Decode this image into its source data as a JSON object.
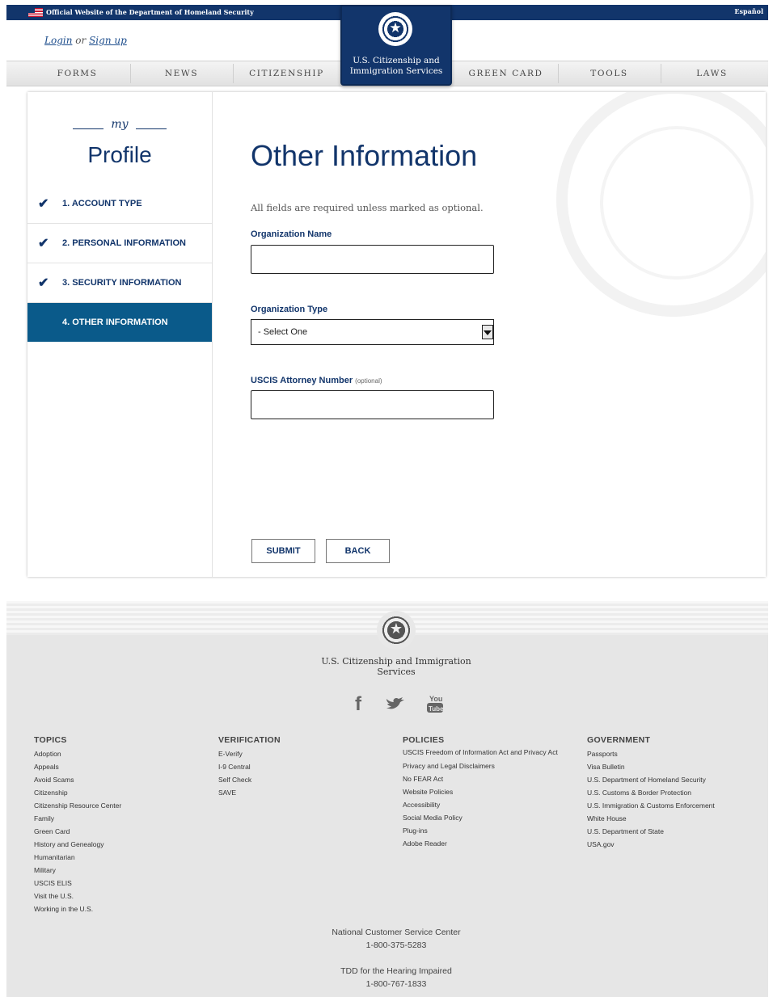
{
  "topbar": {
    "official_text": "Official Website of the Department of Homeland Security",
    "language_link": "Español"
  },
  "header": {
    "login_label": "Login",
    "or_label": "or",
    "signup_label": "Sign up",
    "logo_text": "U.S. Citizenship and Immigration Services",
    "nav": [
      "FORMS",
      "NEWS",
      "CITIZENSHIP",
      "GREEN CARD",
      "TOOLS",
      "LAWS"
    ]
  },
  "sidebar": {
    "decoration_text": "my",
    "title": "Profile",
    "steps": [
      {
        "label": "1. ACCOUNT TYPE",
        "completed": true
      },
      {
        "label": "2. PERSONAL INFORMATION",
        "completed": true
      },
      {
        "label": "3. SECURITY INFORMATION",
        "completed": true
      },
      {
        "label": "4. OTHER INFORMATION",
        "completed": false,
        "active": true
      }
    ],
    "check_icon": "✔"
  },
  "form": {
    "title": "Other Information",
    "required_note": "All fields are required unless marked as optional.",
    "org_name_label": "Organization Name",
    "org_name_value": "",
    "org_type_label": "Organization Type",
    "org_type_selected": "- Select One",
    "attorney_label": "USCIS Attorney Number",
    "attorney_optional": "(optional)",
    "attorney_value": "",
    "submit_label": "SUBMIT",
    "back_label": "BACK"
  },
  "footer": {
    "logo_text": "U.S. Citizenship and Immigration Services",
    "social": [
      "facebook-icon",
      "twitter-icon",
      "youtube-icon"
    ],
    "columns": [
      {
        "heading": "TOPICS",
        "links": [
          "Adoption",
          "Appeals",
          "Avoid Scams",
          "Citizenship",
          "Citizenship Resource Center",
          "Family",
          "Green Card",
          "History and Genealogy",
          "Humanitarian",
          "Military",
          "USCIS ELIS",
          "Visit the U.S.",
          "Working in the U.S."
        ]
      },
      {
        "heading": "VERIFICATION",
        "links": [
          "E-Verify",
          "I-9 Central",
          "Self Check",
          "SAVE"
        ]
      },
      {
        "heading": "POLICIES",
        "links": [
          "USCIS Freedom of Information Act and Privacy Act",
          "Privacy and Legal Disclaimers",
          "No FEAR Act",
          "Website Policies",
          "Accessibility",
          "Social Media Policy",
          "Plug-ins",
          "Adobe Reader"
        ]
      },
      {
        "heading": "GOVERNMENT",
        "links": [
          "Passports",
          "Visa Bulletin",
          "U.S. Department of Homeland Security",
          "U.S. Customs & Border Protection",
          "U.S. Immigration & Customs Enforcement",
          "White House",
          "U.S. Department of State",
          "USA.gov"
        ]
      }
    ],
    "contact": {
      "ncsc_label": "National Customer Service Center",
      "ncsc_phone": "1-800-375-5283",
      "tdd_label": "TDD for the Hearing Impaired",
      "tdd_phone": "1-800-767-1833"
    }
  },
  "colors": {
    "navy": "#12356b",
    "active_step": "#0a5a8a",
    "footer_bg": "#e6e6e6"
  }
}
